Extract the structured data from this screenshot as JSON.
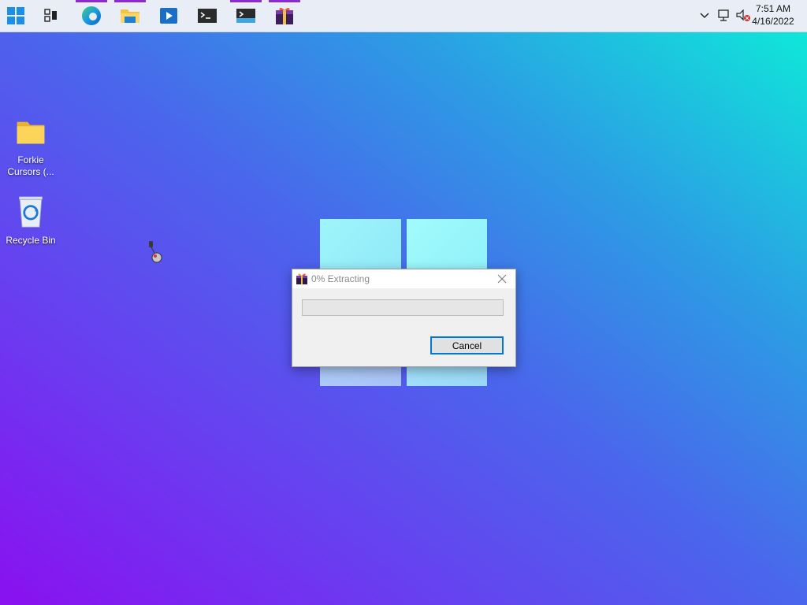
{
  "taskbar": {
    "apps": [
      {
        "name": "start",
        "icon": "windows-logo-icon",
        "active": false
      },
      {
        "name": "task-view",
        "icon": "task-view-icon",
        "active": false
      },
      {
        "name": "edge",
        "icon": "edge-icon",
        "active": true
      },
      {
        "name": "file-explorer",
        "icon": "folder-icon",
        "active": true
      },
      {
        "name": "media-player",
        "icon": "media-player-icon",
        "active": false
      },
      {
        "name": "terminal",
        "icon": "terminal-icon",
        "active": false
      },
      {
        "name": "terminal-2",
        "icon": "terminal-icon",
        "active": true
      },
      {
        "name": "extractor-app",
        "icon": "gift-box-icon",
        "active": true
      }
    ],
    "tray": {
      "time": "7:51 AM",
      "date": "4/16/2022"
    },
    "accent_color": "#8d2ad0"
  },
  "desktop": {
    "icons": [
      {
        "label": "Forkie Cursors (...",
        "icon": "folder-icon"
      },
      {
        "label": "Recycle Bin",
        "icon": "recycle-bin-icon"
      }
    ]
  },
  "dialog": {
    "title": "0% Extracting",
    "progress": 0,
    "cancel_label": "Cancel",
    "focus_color": "#0078d7"
  }
}
